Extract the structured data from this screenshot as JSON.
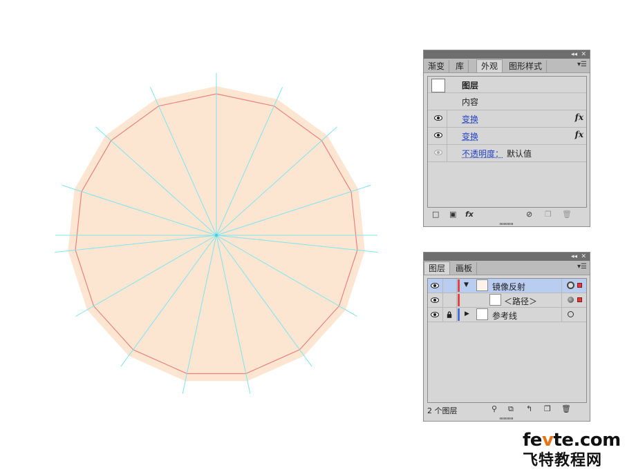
{
  "appearance_panel": {
    "tabs": [
      "渐变",
      "库",
      "外观",
      "图形样式"
    ],
    "active_tab": "外观",
    "rows": [
      {
        "label": "图层",
        "bold": true,
        "eye": "none",
        "link": false,
        "fx": ""
      },
      {
        "label": "内容",
        "bold": false,
        "eye": "none",
        "link": false,
        "fx": ""
      },
      {
        "label": "变换",
        "bold": false,
        "eye": "on",
        "link": true,
        "fx": "fx"
      },
      {
        "label": "变换",
        "bold": false,
        "eye": "on",
        "link": true,
        "fx": "fx"
      },
      {
        "label": "不透明度：",
        "bold": false,
        "eye": "dim",
        "link": true,
        "value": "默认值",
        "fx": ""
      }
    ],
    "bottom_fx": "fx"
  },
  "layers_panel": {
    "tabs": [
      "图层",
      "画板"
    ],
    "active_tab": "图层",
    "rows": [
      {
        "name": "镜像反射",
        "selected": true,
        "locked": false,
        "expanded": "down",
        "color": "#e04545",
        "indent": 0
      },
      {
        "name": "＜路径＞",
        "selected": false,
        "locked": false,
        "expanded": "none",
        "color": "#e04545",
        "indent": 1
      },
      {
        "name": "参考线",
        "selected": false,
        "locked": true,
        "expanded": "right",
        "color": "#4a6fd6",
        "indent": 0
      }
    ],
    "footer_text": "2 个图层"
  },
  "watermark": {
    "line1_a": "fe",
    "line1_b": "v",
    "line1_c": "te.com",
    "line2": "飞特教程网"
  },
  "colors": {
    "shape_fill": "#fde6d1",
    "outline": "#e86f6f",
    "guides": "#7ee4f0",
    "selection": "#b9cdf0"
  }
}
